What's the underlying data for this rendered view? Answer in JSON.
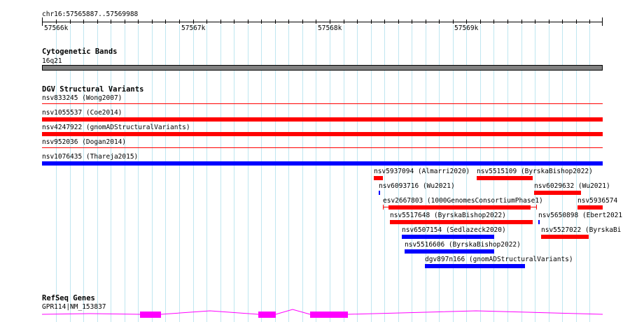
{
  "ruler": {
    "location": "chr16:57565887..57569988",
    "tick_labels": [
      "57566k",
      "57567k",
      "57568k",
      "57569k"
    ]
  },
  "cytoband_track": {
    "title": "Cytogenetic Bands",
    "band_label": "16q21",
    "band_color": "#808080"
  },
  "dgv_track": {
    "title": "DGV Structural Variants",
    "gain_color": "#0000ff",
    "loss_color": "#ff0000",
    "features": [
      {
        "label": "nsv833245 (Wong2007)"
      },
      {
        "label": "nsv1055537 (Coe2014)"
      },
      {
        "label": "nsv4247922 (gnomADStructuralVariants)"
      },
      {
        "label": "nsv952036 (Dogan2014)"
      },
      {
        "label": "nsv1076435 (Thareja2015)"
      },
      {
        "label": "nsv5937094 (Almarri2020)"
      },
      {
        "label": "nsv5515109 (ByrskaBishop2022)"
      },
      {
        "label": "nsv6093716 (Wu2021)"
      },
      {
        "label": "nsv6029632 (Wu2021)"
      },
      {
        "label": "esv2667803 (1000GenomesConsortiumPhase1)"
      },
      {
        "label": "nsv5936574"
      },
      {
        "label": "nsv5517648 (ByrskaBishop2022)"
      },
      {
        "label": "nsv5650898 (Ebert2021"
      },
      {
        "label": "nsv6507154 (Sedlazeck2020)"
      },
      {
        "label": "nsv5527022 (ByrskaBi"
      },
      {
        "label": "nsv5516606 (ByrskaBishop2022)"
      },
      {
        "label": "dgv897n166 (gnomADStructuralVariants)"
      }
    ]
  },
  "refseq_track": {
    "title": "RefSeq Genes",
    "gene_label": "GPR114|NM_153837",
    "gene_color": "#ff00ff"
  }
}
